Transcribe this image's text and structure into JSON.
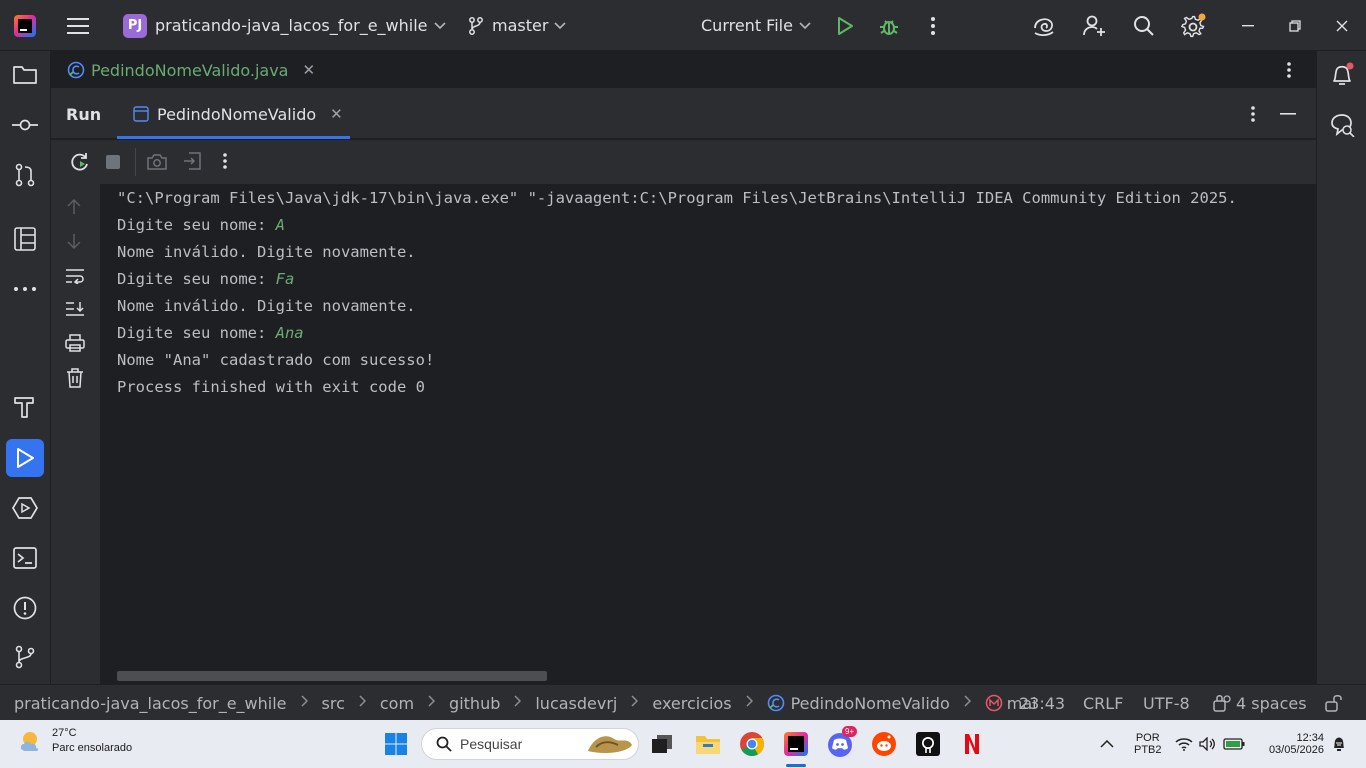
{
  "titlebar": {
    "project_badge": "PJ",
    "project_name": "praticando-java_lacos_for_e_while",
    "branch": "master",
    "run_config": "Current File"
  },
  "editor": {
    "tab_label": "PedindoNomeValido.java"
  },
  "run_window": {
    "title": "Run",
    "tab_label": "PedindoNomeValido"
  },
  "console": {
    "lines": [
      {
        "text": "\"C:\\Program Files\\Java\\jdk-17\\bin\\java.exe\" \"-javaagent:C:\\Program Files\\JetBrains\\IntelliJ IDEA Community Edition 2025.",
        "input": ""
      },
      {
        "text": "Digite seu nome: ",
        "input": "A"
      },
      {
        "text": "Nome inválido. Digite novamente.",
        "input": ""
      },
      {
        "text": "Digite seu nome: ",
        "input": "Fa"
      },
      {
        "text": "Nome inválido. Digite novamente.",
        "input": ""
      },
      {
        "text": "Digite seu nome: ",
        "input": "Ana"
      },
      {
        "text": "Nome \"Ana\" cadastrado com sucesso!",
        "input": ""
      },
      {
        "text": "Process finished with exit code 0",
        "input": ""
      }
    ]
  },
  "breadcrumb": [
    "praticando-java_lacos_for_e_while",
    "src",
    "com",
    "github",
    "lucasdevrj",
    "exercicios",
    "PedindoNomeValido",
    "mai"
  ],
  "status": {
    "position": "23:43",
    "line_sep": "CRLF",
    "encoding": "UTF-8",
    "indent": "4 spaces"
  },
  "taskbar": {
    "temp": "27°C",
    "weather_desc": "Parc ensolarado",
    "search_placeholder": "Pesquisar",
    "discord_badge": "9+",
    "lang1": "POR",
    "lang2": "PTB2",
    "time": "12:34",
    "date": "03/05/2026"
  },
  "colors": {
    "accent": "#3574f0",
    "input_green": "#6aab73",
    "panel": "#2b2d30",
    "background": "#1e1f22"
  }
}
